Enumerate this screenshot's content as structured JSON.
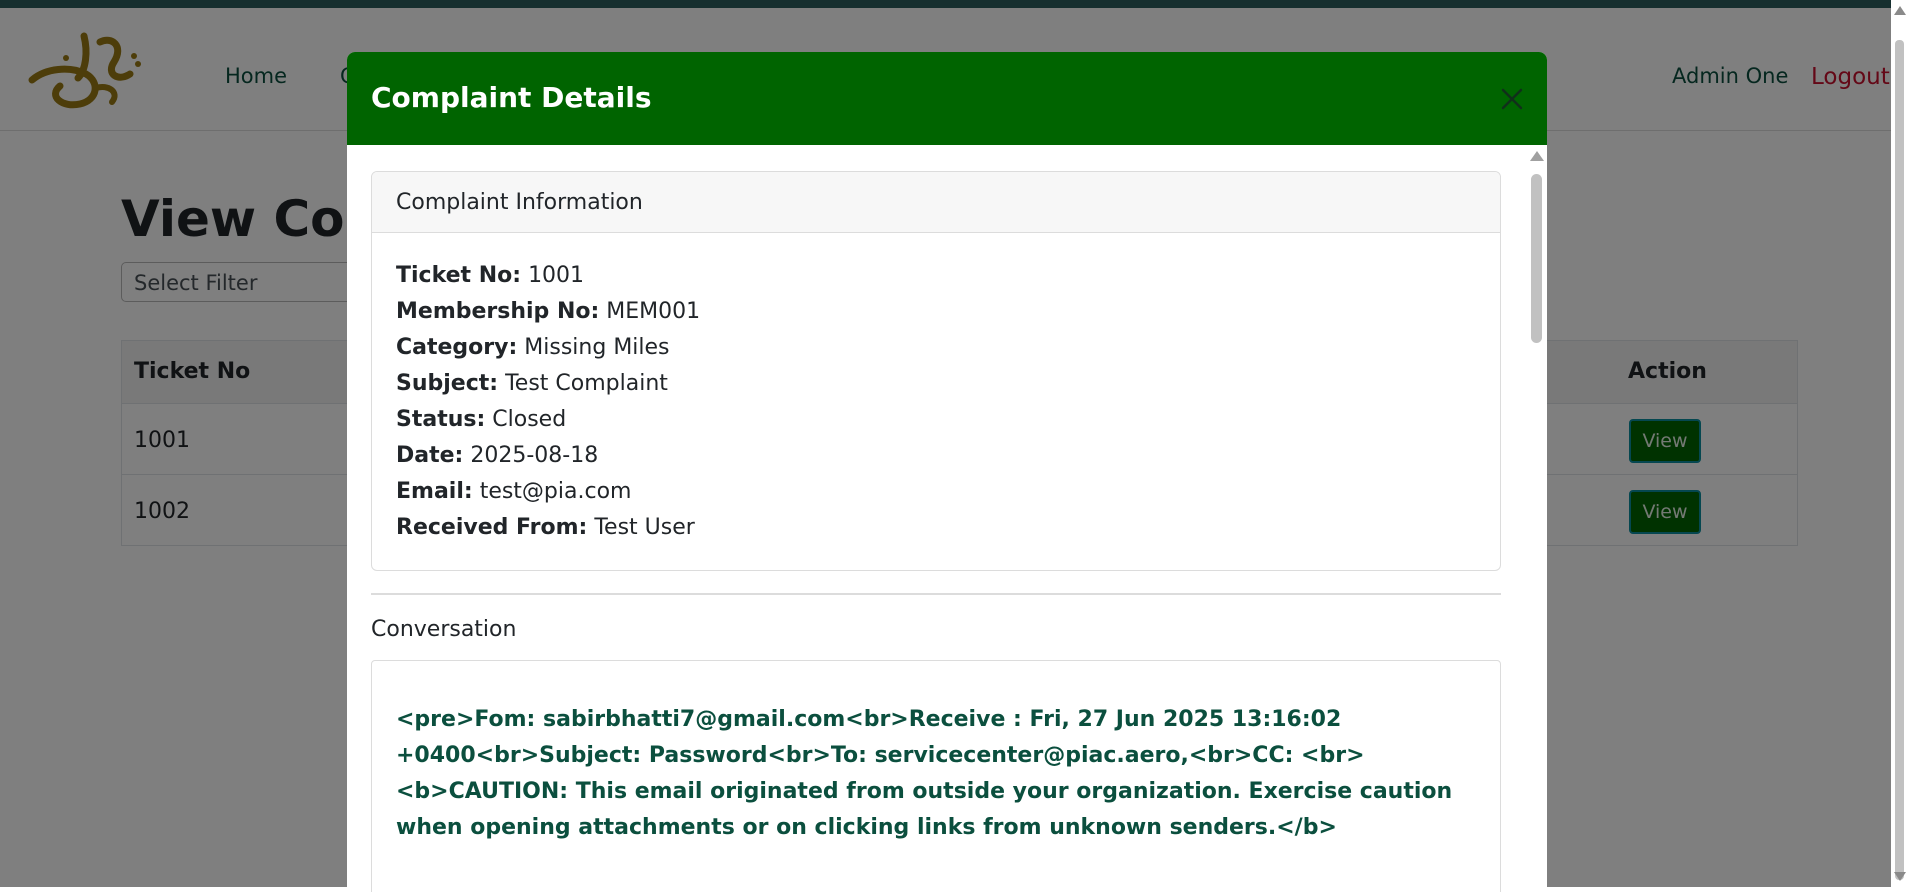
{
  "navbar": {
    "nav_items": [
      "Home",
      "C"
    ],
    "user_name": "Admin One",
    "logout_label": "Logout"
  },
  "page": {
    "title": "View Comp",
    "filter_placeholder": "Select Filter",
    "table": {
      "headers": {
        "ticket_no": "Ticket No",
        "action": "Action"
      },
      "rows": [
        {
          "ticket_no": "1001",
          "action_label": "View"
        },
        {
          "ticket_no": "1002",
          "action_label": "View"
        }
      ]
    }
  },
  "modal": {
    "title": "Complaint Details",
    "info_card": {
      "title": "Complaint Information",
      "fields": [
        {
          "label": "Ticket No:",
          "value": "1001"
        },
        {
          "label": "Membership No:",
          "value": "MEM001"
        },
        {
          "label": "Category:",
          "value": "Missing Miles"
        },
        {
          "label": "Subject:",
          "value": "Test Complaint"
        },
        {
          "label": "Status:",
          "value": "Closed"
        },
        {
          "label": "Date:",
          "value": "2025-08-18"
        },
        {
          "label": "Email:",
          "value": "test@pia.com"
        },
        {
          "label": "Received From:",
          "value": "Test User"
        }
      ]
    },
    "conversation": {
      "title": "Conversation",
      "message": "<pre>Fom: sabirbhatti7@gmail.com<br>Receive : Fri, 27 Jun 2025 13:16:02 +0400<br>Subject: Password<br>To: servicecenter@piac.aero,<br>CC: <br><b>CAUTION: This email originated from outside your organization. Exercise caution when opening attachments or on clicking links from unknown senders.</b>"
    }
  },
  "colors": {
    "modal_header": "#006400",
    "view_button": "#006400",
    "nav_text": "#0b4f3e",
    "logout": "#c8102e",
    "logo_gold": "#9a7b14",
    "conversation_text": "#0b4f3e"
  },
  "icons": {
    "logo": "airline-calligraphy-logo",
    "close": "close-icon"
  }
}
